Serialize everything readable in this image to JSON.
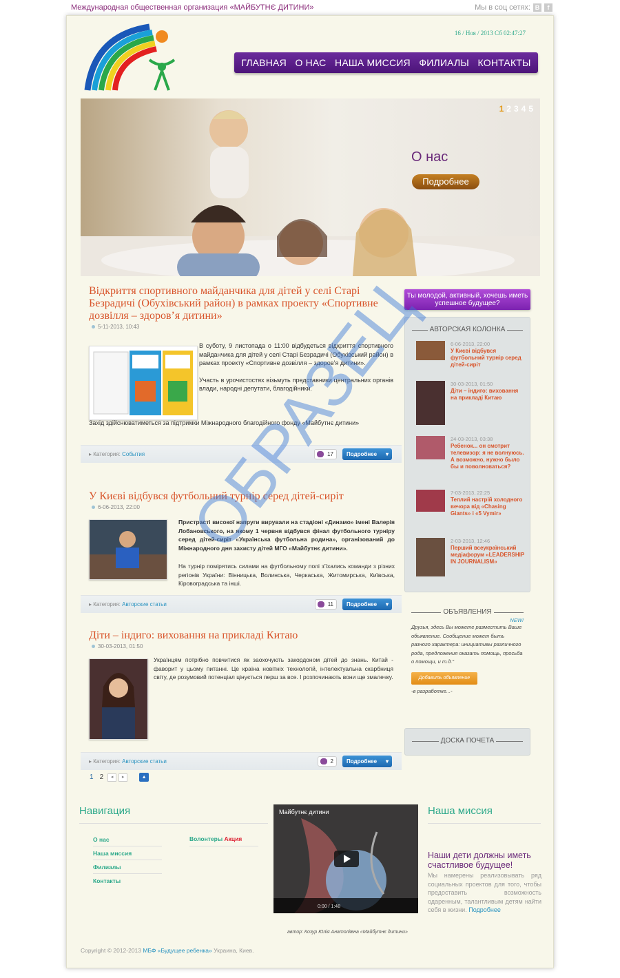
{
  "topbar": {
    "org": "Международная общественная организация «МАЙБУТНЄ ДИТИНИ»",
    "social_label": "Мы в соц сетях:",
    "social_b": "B",
    "social_f": "f"
  },
  "header": {
    "datetime": "16 / Ноя / 2013 Сб 02:47:27",
    "nav": [
      "ГЛАВНАЯ",
      "О НАС",
      "НАША МИССИЯ",
      "ФИЛИАЛЫ",
      "КОНТАКТЫ"
    ]
  },
  "slider": {
    "pages": [
      "1",
      "2",
      "3",
      "4",
      "5"
    ],
    "title": "О нас",
    "button": "Подробнее"
  },
  "articles": [
    {
      "title": "Відкриття спортивного майданчика для дітей у селі Старі Безрадичі (Обухівський район) в рамках проекту «Спортивне дозвілля – здоров’я дитини»",
      "date": "5-11-2013, 10:43",
      "p1": "В суботу, 9 листопада о 11:00 відбудеться відкриття спортивного майданчика для дітей у селі Старі Безрадичі (Обухівський район) в рамках проекту «Спортивне дозвілля – здоров’я дитини».",
      "p2": "Участь в урочистостях візьмуть представники центральних органів влади, народні депутати, благодійники.",
      "p3": "Захід здійснюватиметься за підтримки Міжнародного благодійного фонду «Майбутнє дитини»",
      "category_label": "Категория:",
      "category": "События",
      "comments": "17",
      "more": "Подробнее"
    },
    {
      "title": "У Києві відбувся футбольний турнір серед дітей-сиріт",
      "date": "6-06-2013, 22:00",
      "p1": "Пристрасті високої напруги вирували на стадіоні «Динамо» імені Валерія Лобановського, на якому 1 червня відбувся фінал футбольного турніру серед дітей-сиріт «Українська футбольна родина», організований до Міжнародного дня захисту дітей МГО «Майбутнє дитини».",
      "p2": "На турнір помірятись силами на футбольному полі з’їхались команди з різних регіонів України: Вінницька, Волинська, Черкаська, Житомирська, Київська, Кіровоградська та інші.",
      "category_label": "Категория:",
      "category": "Авторские статьи",
      "comments": "11",
      "more": "Подробнее"
    },
    {
      "title": "Діти – індиго: виховання на прикладі Китаю",
      "date": "30-03-2013, 01:50",
      "p1": "Українцям потрібно повчитися як заохочують закордоном дітей до знань. Китай - фаворит у цьому питанні. Це країна новітніх технологій, інтелектуальна скарбниця світу, де розумовий потенціал цінується перш за все. І розпочинають вони ще змалечку.",
      "category_label": "Категория:",
      "category": "Авторские статьи",
      "comments": "2",
      "more": "Подробнее"
    }
  ],
  "paging": {
    "pages": [
      "1",
      "2"
    ],
    "prev": "◂",
    "next": "▸",
    "up": "▲"
  },
  "sidebar": {
    "cta": "Ты молодой, активный, хочешь иметь успешное будущее?",
    "author_title": "АВТОРСКАЯ КОЛОНКА",
    "authors": [
      {
        "date": "6-06-2013, 22:00",
        "title": "У Києві відбувся футбольний турнір серед дітей-сиріт"
      },
      {
        "date": "30-03-2013, 01:50",
        "title": "Діти – індиго: виховання на прикладі Китаю"
      },
      {
        "date": "24-03-2013, 03:38",
        "title": "Ребенок... он смотрит телевизор: я не волнуюсь. А возможно, нужно было бы и поволноваться?"
      },
      {
        "date": "7-03-2013, 22:25",
        "title": "Теплий настрій холодного вечора від «Chasing Giants» і «5 Vymir»"
      },
      {
        "date": "2-03-2013, 12:46",
        "title": "Перший всеукраїнський медіафорум «LEADERSHIP IN JOURNALISM»"
      }
    ],
    "ads_title": "ОБЪЯВЛЕНИЯ",
    "ads_new": "NEW!",
    "ads_text": "Друзья, здесь Вы можете разместить Ваше объявление. Сообщение может быть разного характера: инициативы различного рода, предложения оказать помощь, просьба о помощи, и т.д.\"",
    "ads_button": "Добавить объявление",
    "ads_note": "-в разработке...-",
    "honor_title": "ДОСКА ПОЧЕТА"
  },
  "footer": {
    "nav_title": "Навигация",
    "nav_links": [
      "О нас",
      "Наша миссия",
      "Филиалы",
      "Контакты"
    ],
    "volunteers": "Волонтеры",
    "volunteers_badge": "Акция",
    "video_title": "Майбутнє дитини",
    "video_time": "0:00 / 1:48",
    "video_caption": "автор: Козур Юлія Анатоліївна «Майбутнє дитини»",
    "mission_title": "Наша миссия",
    "mission_heading": "Наши дети должны иметь счастливое будущее!",
    "mission_text": "Мы намерены реализовывать ряд социальных проектов для того, чтобы предоставить возможность одаренным, талантливым детям найти себя в жизни.",
    "mission_more": "Подробнее",
    "copyright": "Copyright © 2012-2013",
    "copyright_org": "МБФ «Будущее ребенка»",
    "copyright_place": "Украина, Киев."
  },
  "watermark": "ОБРАЗЕЦ"
}
